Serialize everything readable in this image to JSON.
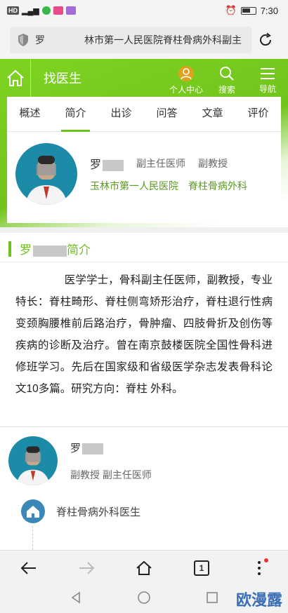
{
  "status_bar": {
    "left_indicators": "HD",
    "time": "7:30"
  },
  "url_bar": {
    "url_text": "罗　　　　林市第一人民医院脊柱骨病外科副主"
  },
  "top_nav": {
    "title": "找医生",
    "personal_center": "个人中心",
    "search": "搜索",
    "menu": "导航"
  },
  "tabs": [
    {
      "label": "概述",
      "active": false
    },
    {
      "label": "简介",
      "active": true
    },
    {
      "label": "出诊",
      "active": false
    },
    {
      "label": "问答",
      "active": false
    },
    {
      "label": "文章",
      "active": false
    },
    {
      "label": "评价",
      "active": false
    }
  ],
  "doctor": {
    "name": "罗",
    "title": "副主任医师",
    "academic": "副教授",
    "hospital": "玉林市第一人民医院",
    "department": "脊柱骨病外科"
  },
  "section": {
    "title_prefix": "罗",
    "title_suffix": "简介"
  },
  "intro_text": "医学学士，骨科副主任医师，副教授，专业特长：脊柱畸形、脊柱侧弯矫形治疗，脊柱退行性病变颈胸腰椎前后路治疗，骨肿瘤、四肢骨折及创伤等疾病的诊断及治疗。曾在南京鼓楼医院全国性骨科进修班学习。先后在国家级和省级医学杂志发表骨科论文10多篇。研究方向：脊柱 外科。",
  "doctor2": {
    "name": "罗",
    "titles": "副教授 副主任医师"
  },
  "dept": {
    "label": "脊柱骨病外科医生"
  },
  "browser": {
    "tab_count": "1"
  },
  "watermark": "欧漫露",
  "colors": {
    "accent": "#6cc11e",
    "avatar_bg": "#1c8ba8"
  }
}
